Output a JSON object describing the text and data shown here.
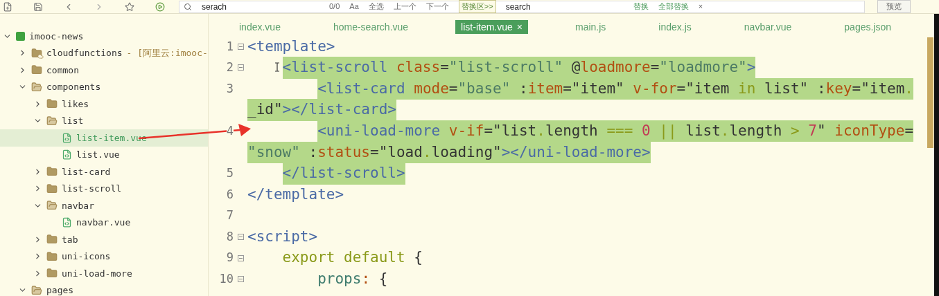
{
  "toolbar": {
    "search_value": "serach",
    "match_count": "0/0",
    "case_toggle": "Aa",
    "select_all": "全选",
    "prev": "上一个",
    "next": "下一个",
    "replace_toggle": "替换区>>",
    "replace_value": "search",
    "replace": "替换",
    "replace_all": "全部替换",
    "close": "×",
    "preview": "预览"
  },
  "tabs": [
    {
      "label": "index.vue",
      "selected": false
    },
    {
      "label": "home-search.vue",
      "selected": false
    },
    {
      "label": "list-item.vue",
      "selected": true
    },
    {
      "label": "main.js",
      "selected": false
    },
    {
      "label": "index.js",
      "selected": false
    },
    {
      "label": "navbar.vue",
      "selected": false
    },
    {
      "label": "pages.json",
      "selected": false
    }
  ],
  "tab_close": "×",
  "tree": [
    {
      "label": "imooc-news",
      "kind": "project",
      "expanded": true,
      "selected": false,
      "children": [
        {
          "label": "cloudfunctions",
          "note": "- [阿里云:imooc-",
          "kind": "cloud-folder",
          "expanded": false,
          "selected": false
        },
        {
          "label": "common",
          "kind": "folder",
          "expanded": false,
          "selected": false
        },
        {
          "label": "components",
          "kind": "folder",
          "expanded": true,
          "selected": false,
          "children": [
            {
              "label": "likes",
              "kind": "folder",
              "expanded": false,
              "selected": false
            },
            {
              "label": "list",
              "kind": "folder",
              "expanded": true,
              "selected": false,
              "children": [
                {
                  "label": "list-item.vue",
                  "kind": "file",
                  "selected": true
                },
                {
                  "label": "list.vue",
                  "kind": "file",
                  "selected": false
                }
              ]
            },
            {
              "label": "list-card",
              "kind": "folder",
              "expanded": false,
              "selected": false
            },
            {
              "label": "list-scroll",
              "kind": "folder",
              "expanded": false,
              "selected": false
            },
            {
              "label": "navbar",
              "kind": "folder",
              "expanded": true,
              "selected": false,
              "children": [
                {
                  "label": "navbar.vue",
                  "kind": "file",
                  "selected": false
                }
              ]
            },
            {
              "label": "tab",
              "kind": "folder",
              "expanded": false,
              "selected": false
            },
            {
              "label": "uni-icons",
              "kind": "folder",
              "expanded": false,
              "selected": false
            },
            {
              "label": "uni-load-more",
              "kind": "folder",
              "expanded": false,
              "selected": false
            }
          ]
        },
        {
          "label": "pages",
          "kind": "folder",
          "expanded": true,
          "selected": false
        }
      ]
    }
  ],
  "code": [
    {
      "number": "1",
      "fold": true,
      "selected": false,
      "tokens": [
        {
          "kind": "tag",
          "text": "<template>"
        }
      ]
    },
    {
      "number": "2",
      "fold": true,
      "selected": true,
      "tokens": [
        {
          "kind": "tag",
          "text": "    <list-scroll"
        },
        {
          "kind": "attr",
          "text": " class"
        },
        {
          "kind": "plain",
          "text": "="
        },
        {
          "kind": "str",
          "text": "\"list-scroll\""
        },
        {
          "kind": "plain",
          "text": " @"
        },
        {
          "kind": "attr",
          "text": "loadmore"
        },
        {
          "kind": "plain",
          "text": "="
        },
        {
          "kind": "str",
          "text": "\"loadmore\""
        },
        {
          "kind": "tag",
          "text": ">"
        }
      ]
    },
    {
      "number": "3",
      "fold": false,
      "selected": true,
      "tokens": [
        {
          "kind": "tag",
          "text": "        <list-card"
        },
        {
          "kind": "attr",
          "text": " mode"
        },
        {
          "kind": "plain",
          "text": "="
        },
        {
          "kind": "str",
          "text": "\"base\""
        },
        {
          "kind": "plain",
          "text": " :"
        },
        {
          "kind": "attr",
          "text": "item"
        },
        {
          "kind": "plain",
          "text": "=\"item\" "
        },
        {
          "kind": "attr",
          "text": "v-for"
        },
        {
          "kind": "plain",
          "text": "=\"item "
        },
        {
          "kind": "kw",
          "text": "in"
        },
        {
          "kind": "plain",
          "text": " list\" :"
        },
        {
          "kind": "attr",
          "text": "key"
        },
        {
          "kind": "plain",
          "text": "=\"item"
        },
        {
          "kind": "kw",
          "text": "."
        }
      ]
    },
    {
      "fold": false,
      "selected": true,
      "tokens": [
        {
          "kind": "plain",
          "text": "_id\""
        },
        {
          "kind": "tag",
          "text": "></list-card>"
        }
      ]
    },
    {
      "number": "4",
      "fold": false,
      "selected": true,
      "tokens": [
        {
          "kind": "tag",
          "text": "        <uni-load-more"
        },
        {
          "kind": "attr",
          "text": " v-if"
        },
        {
          "kind": "plain",
          "text": "=\"list"
        },
        {
          "kind": "kw",
          "text": "."
        },
        {
          "kind": "plain",
          "text": "length "
        },
        {
          "kind": "kw",
          "text": "==="
        },
        {
          "kind": "num",
          "text": " 0"
        },
        {
          "kind": "kw",
          "text": " ||"
        },
        {
          "kind": "plain",
          "text": " list"
        },
        {
          "kind": "kw",
          "text": "."
        },
        {
          "kind": "plain",
          "text": "length "
        },
        {
          "kind": "kw",
          "text": ">"
        },
        {
          "kind": "num",
          "text": " 7"
        },
        {
          "kind": "plain",
          "text": "\" "
        },
        {
          "kind": "attr",
          "text": "iconType"
        },
        {
          "kind": "plain",
          "text": "="
        }
      ]
    },
    {
      "fold": false,
      "selected": true,
      "tokens": [
        {
          "kind": "str",
          "text": "\"snow\""
        },
        {
          "kind": "plain",
          "text": " :"
        },
        {
          "kind": "attr",
          "text": "status"
        },
        {
          "kind": "plain",
          "text": "=\"load"
        },
        {
          "kind": "kw",
          "text": "."
        },
        {
          "kind": "plain",
          "text": "loading\""
        },
        {
          "kind": "tag",
          "text": "></uni-load-more>"
        }
      ]
    },
    {
      "number": "5",
      "fold": false,
      "selected": true,
      "tokens": [
        {
          "kind": "tag",
          "text": "    </list-scroll>"
        }
      ]
    },
    {
      "number": "6",
      "fold": false,
      "selected": false,
      "tokens": [
        {
          "kind": "tag",
          "text": "</template>"
        }
      ]
    },
    {
      "number": "7"
    },
    {
      "number": "8",
      "fold": true,
      "selected": false,
      "tokens": [
        {
          "kind": "tag",
          "text": "<script>"
        }
      ]
    },
    {
      "number": "9",
      "fold": true,
      "selected": false,
      "tokens": [
        {
          "kind": "kw",
          "text": "    export default"
        },
        {
          "kind": "plain",
          "text": " {"
        }
      ]
    },
    {
      "number": "10",
      "fold": true,
      "selected": false,
      "tokens": [
        {
          "kind": "prop",
          "text": "        props"
        },
        {
          "kind": "attr",
          "text": ":"
        },
        {
          "kind": "plain",
          "text": " {"
        }
      ]
    }
  ]
}
